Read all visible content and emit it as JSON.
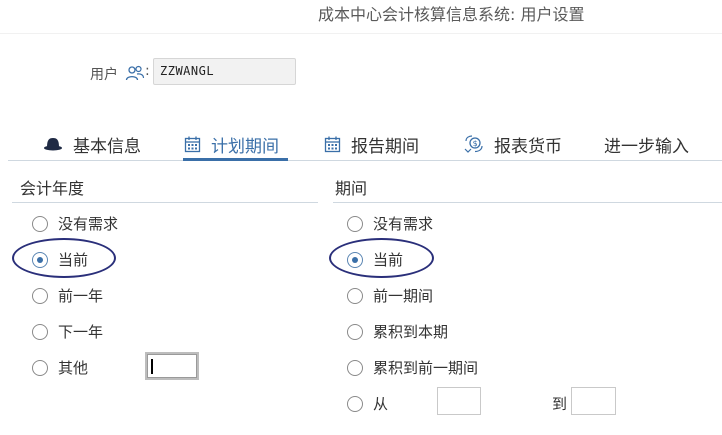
{
  "window": {
    "title": "成本中心会计核算信息系统: 用户设置"
  },
  "user": {
    "label": "用户",
    "colon": ":",
    "value": "ZZWANGL"
  },
  "tabs": [
    {
      "label": "基本信息",
      "icon": "hat-icon",
      "active": false
    },
    {
      "label": "计划期间",
      "icon": "calendar-icon",
      "active": true
    },
    {
      "label": "报告期间",
      "icon": "calendar-icon",
      "active": false
    },
    {
      "label": "报表货币",
      "icon": "currency-exchange-icon",
      "active": false
    },
    {
      "label": "进一步输入",
      "icon": "",
      "active": false
    }
  ],
  "fiscal_year": {
    "heading": "会计年度",
    "options": [
      {
        "label": "没有需求",
        "checked": false
      },
      {
        "label": "当前",
        "checked": true
      },
      {
        "label": "前一年",
        "checked": false
      },
      {
        "label": "下一年",
        "checked": false
      },
      {
        "label": "其他",
        "checked": false
      }
    ],
    "other_value": ""
  },
  "period": {
    "heading": "期间",
    "options": [
      {
        "label": "没有需求",
        "checked": false
      },
      {
        "label": "当前",
        "checked": true
      },
      {
        "label": "前一期间",
        "checked": false
      },
      {
        "label": "累积到本期",
        "checked": false
      },
      {
        "label": "累积到前一期间",
        "checked": false
      },
      {
        "label": "从",
        "checked": false
      }
    ],
    "from_value": "",
    "to_label": "到",
    "to_value": ""
  },
  "colors": {
    "accent": "#3a6fa8",
    "highlight_ellipse": "#2a2f7a"
  }
}
